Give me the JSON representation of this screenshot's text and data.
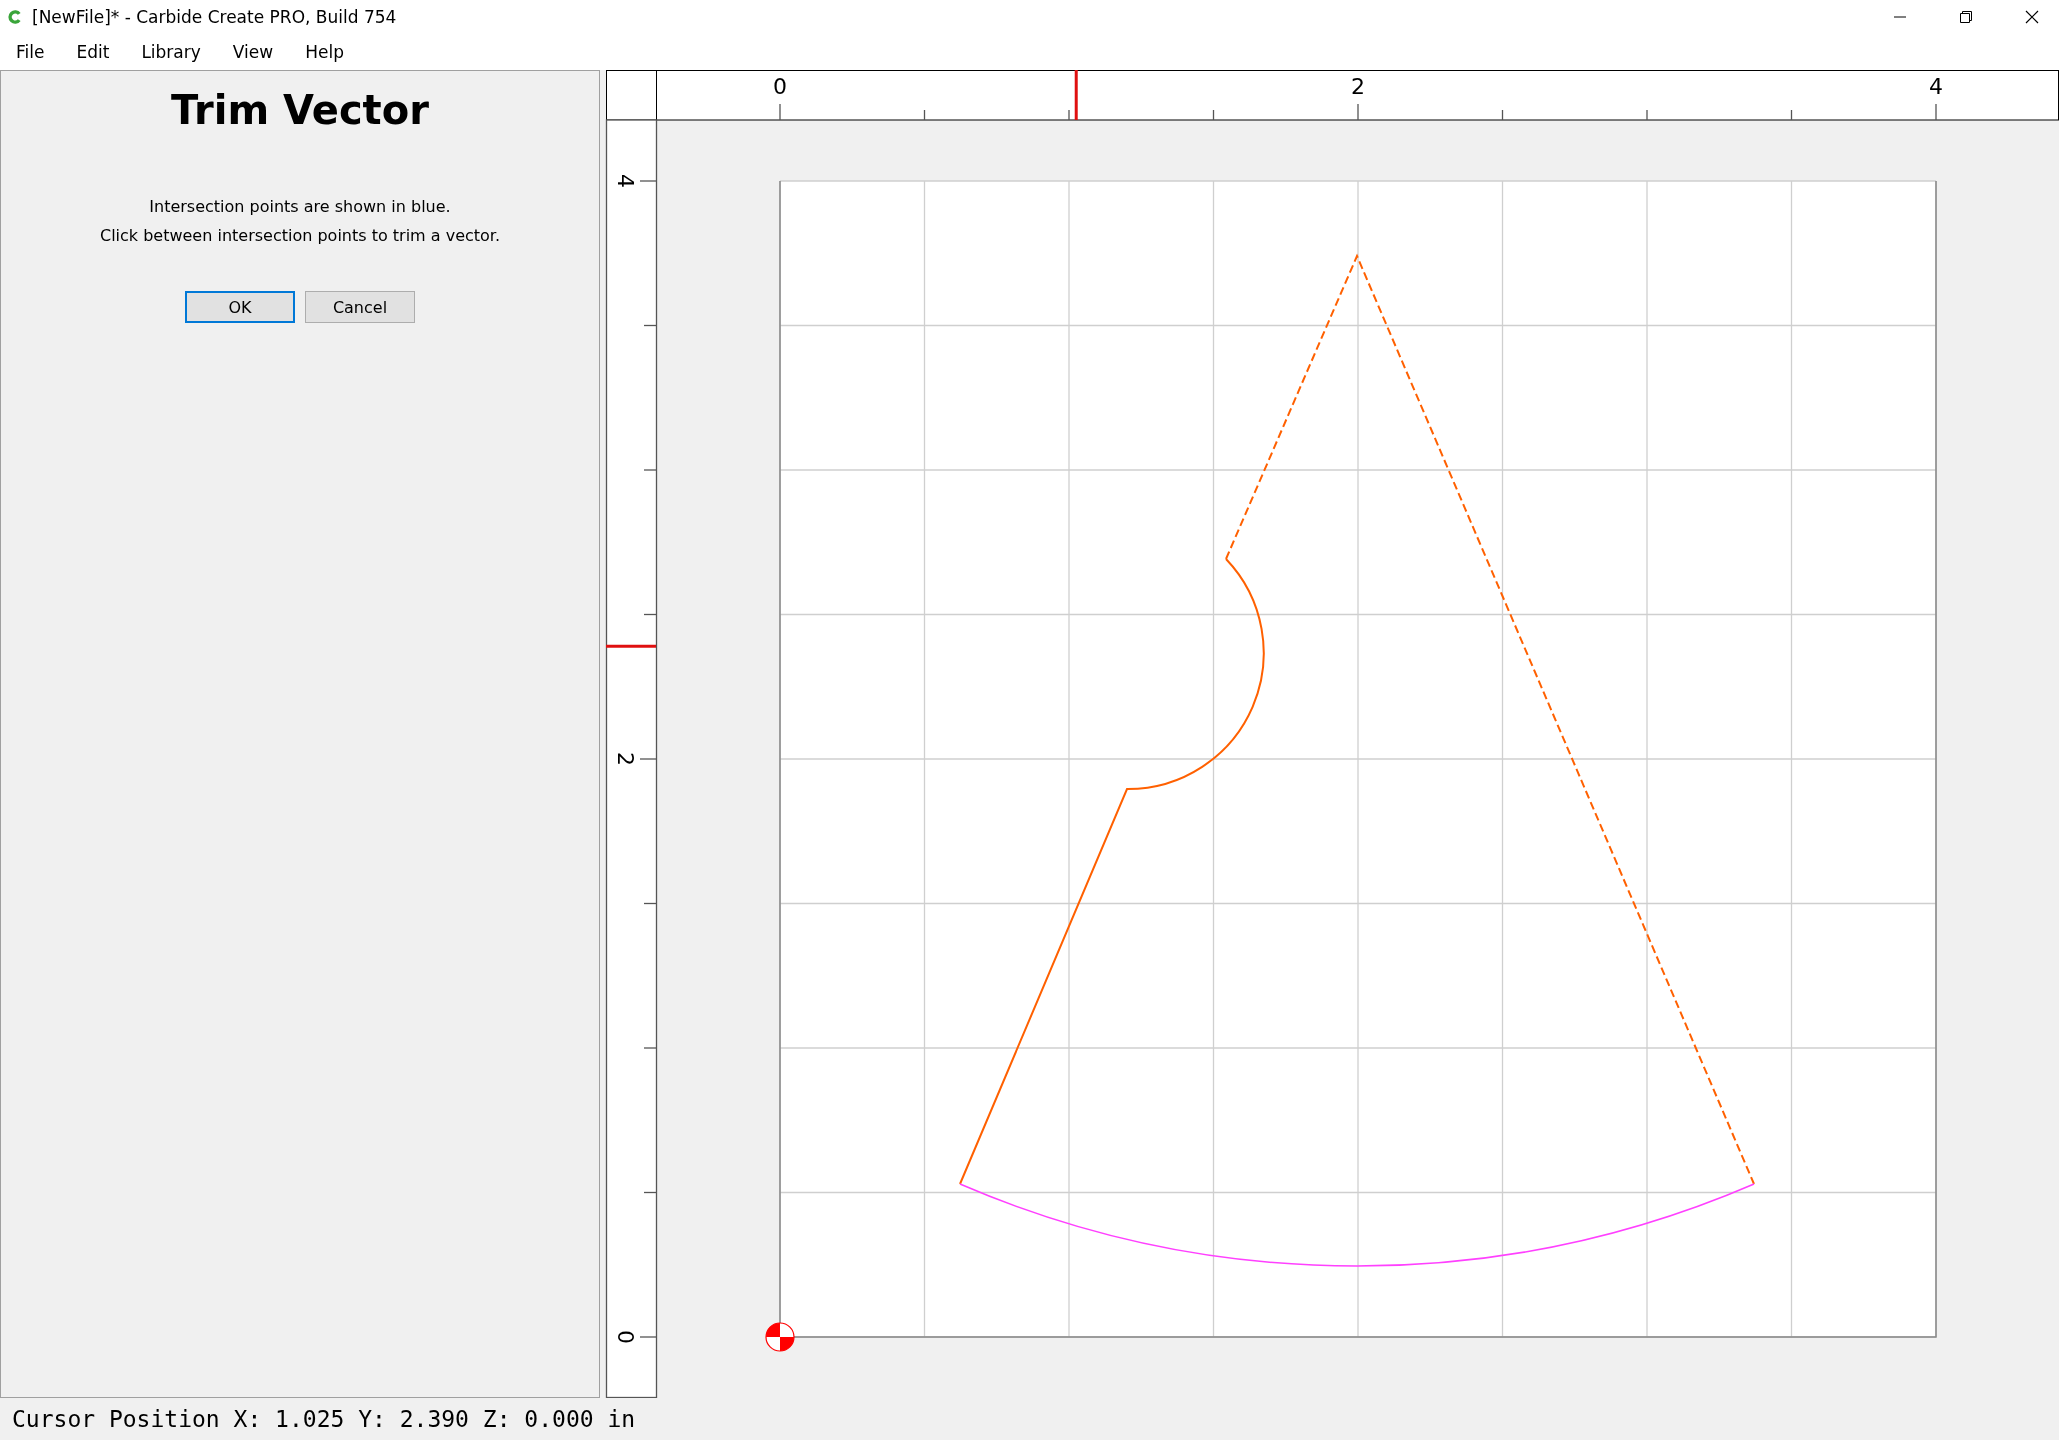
{
  "window": {
    "title": "[NewFile]* - Carbide Create PRO, Build 754"
  },
  "menu": [
    {
      "label": "File"
    },
    {
      "label": "Edit"
    },
    {
      "label": "Library"
    },
    {
      "label": "View"
    },
    {
      "label": "Help"
    }
  ],
  "panel": {
    "title": "Trim Vector",
    "instructions": [
      "Intersection points are shown in blue.",
      "Click between intersection points to trim a vector."
    ],
    "buttons": [
      {
        "label": "OK",
        "default": true
      },
      {
        "label": "Cancel",
        "default": false
      }
    ]
  },
  "rulers": {
    "x_labels": [
      "0",
      "2",
      "4"
    ],
    "y_labels": [
      "0",
      "2",
      "4"
    ]
  },
  "status_bar": "Cursor Position X: 1.025 Y: 2.390 Z: 0.000 in"
}
